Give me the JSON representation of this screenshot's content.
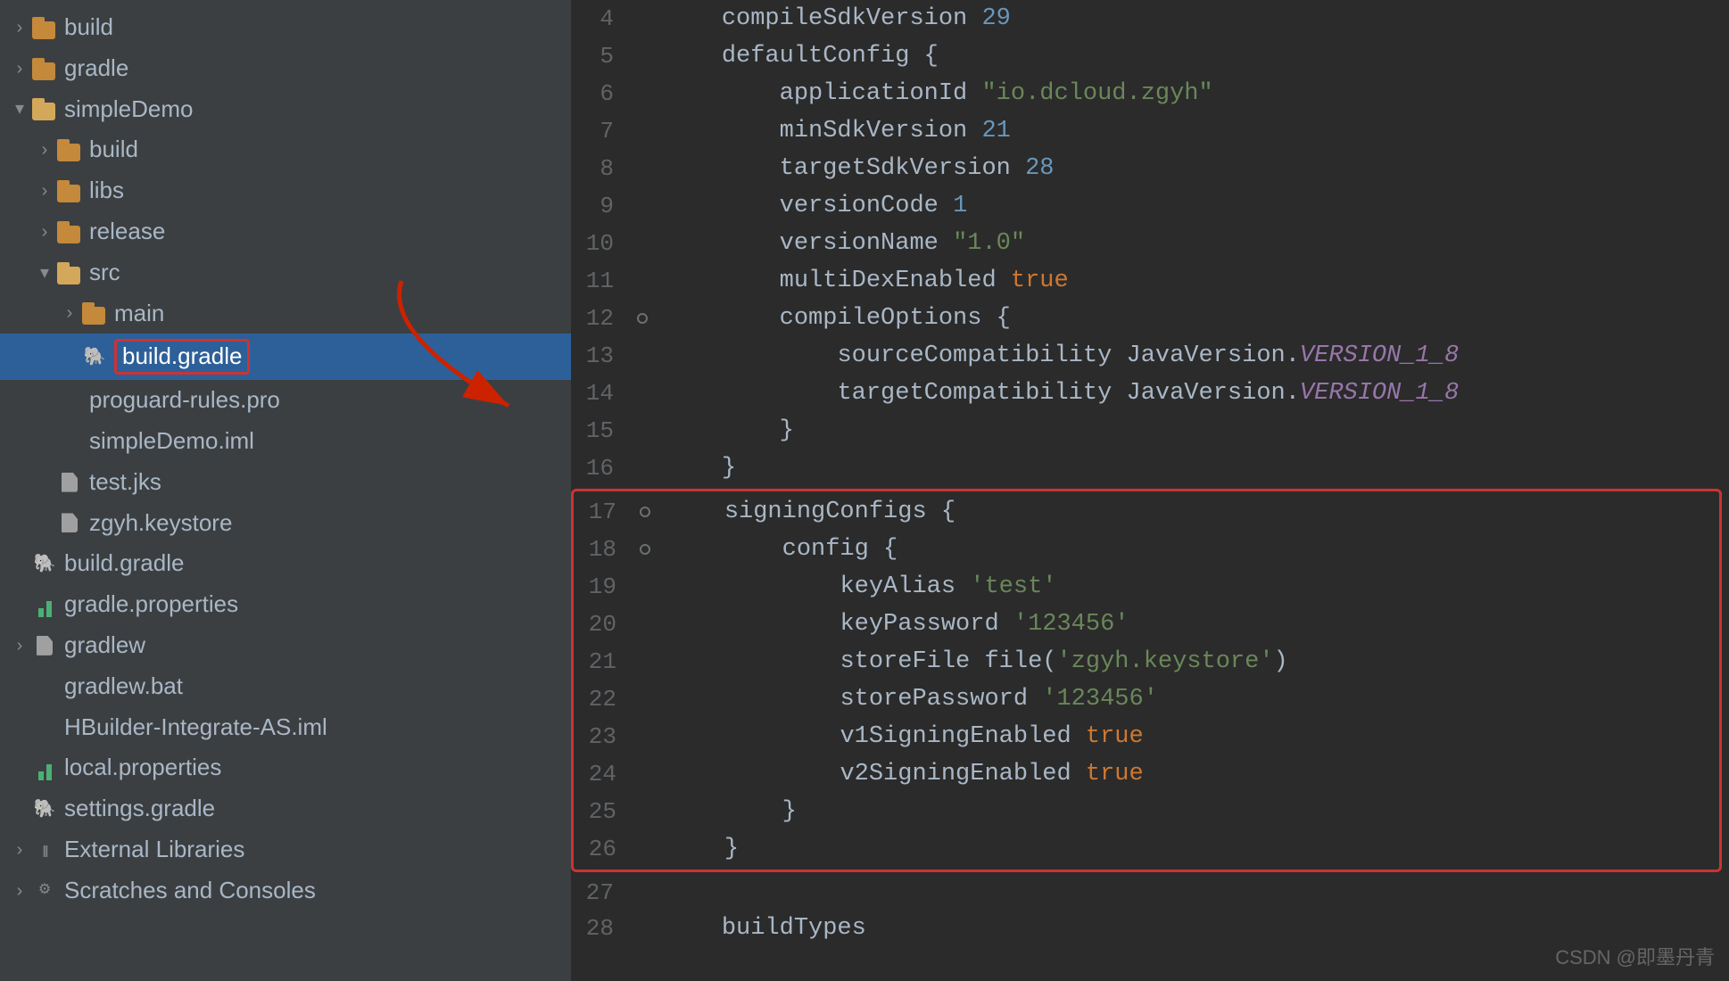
{
  "sidebar": {
    "items": [
      {
        "id": "build-top",
        "label": "build",
        "indent": 0,
        "icon": "folder",
        "chevron": "closed",
        "selected": false
      },
      {
        "id": "gradle",
        "label": "gradle",
        "indent": 0,
        "icon": "folder",
        "chevron": "closed",
        "selected": false
      },
      {
        "id": "simpleDemo",
        "label": "simpleDemo",
        "indent": 0,
        "icon": "folder",
        "chevron": "open",
        "selected": false
      },
      {
        "id": "build",
        "label": "build",
        "indent": 1,
        "icon": "folder",
        "chevron": "closed",
        "selected": false
      },
      {
        "id": "libs",
        "label": "libs",
        "indent": 1,
        "icon": "folder",
        "chevron": "closed",
        "selected": false
      },
      {
        "id": "release",
        "label": "release",
        "indent": 1,
        "icon": "folder",
        "chevron": "closed",
        "selected": false
      },
      {
        "id": "src",
        "label": "src",
        "indent": 1,
        "icon": "folder-open",
        "chevron": "open",
        "selected": false
      },
      {
        "id": "main",
        "label": "main",
        "indent": 2,
        "icon": "folder",
        "chevron": "closed",
        "selected": false
      },
      {
        "id": "build-gradle-child",
        "label": "build.gradle",
        "indent": 2,
        "icon": "gradle",
        "chevron": "empty",
        "selected": true
      },
      {
        "id": "proguard",
        "label": "proguard-rules.pro",
        "indent": 1,
        "icon": "file-pro",
        "chevron": "empty",
        "selected": false
      },
      {
        "id": "simpleDemo-iml",
        "label": "simpleDemo.iml",
        "indent": 1,
        "icon": "file-iml",
        "chevron": "empty",
        "selected": false
      },
      {
        "id": "test-jks",
        "label": "test.jks",
        "indent": 1,
        "icon": "file",
        "chevron": "empty",
        "selected": false
      },
      {
        "id": "zgyh-keystore",
        "label": "zgyh.keystore",
        "indent": 1,
        "icon": "file",
        "chevron": "empty",
        "selected": false
      },
      {
        "id": "build-gradle-root",
        "label": "build.gradle",
        "indent": 0,
        "icon": "gradle",
        "chevron": "empty",
        "selected": false
      },
      {
        "id": "gradle-properties",
        "label": "gradle.properties",
        "indent": 0,
        "icon": "chart",
        "chevron": "empty",
        "selected": false
      },
      {
        "id": "gradlew",
        "label": "gradlew",
        "indent": 0,
        "icon": "file",
        "chevron": "closed",
        "selected": false
      },
      {
        "id": "gradlew-bat",
        "label": "gradlew.bat",
        "indent": 0,
        "icon": "file-pro",
        "chevron": "empty",
        "selected": false
      },
      {
        "id": "hbuilder-iml",
        "label": "HBuilder-Integrate-AS.iml",
        "indent": 0,
        "icon": "file-iml",
        "chevron": "empty",
        "selected": false
      },
      {
        "id": "local-properties",
        "label": "local.properties",
        "indent": 0,
        "icon": "chart",
        "chevron": "empty",
        "selected": false
      },
      {
        "id": "settings-gradle",
        "label": "settings.gradle",
        "indent": 0,
        "icon": "gradle",
        "chevron": "empty",
        "selected": false
      },
      {
        "id": "external-libraries",
        "label": "External Libraries",
        "indent": 0,
        "icon": "ext",
        "chevron": "closed",
        "selected": false
      },
      {
        "id": "scratches",
        "label": "Scratches and Consoles",
        "indent": 0,
        "icon": "scratches",
        "chevron": "closed",
        "selected": false
      }
    ]
  },
  "code": {
    "lines": [
      {
        "num": 4,
        "gutter": false,
        "content": "    compileSdkVersion 29",
        "tokens": [
          {
            "t": "normal",
            "v": "    compileSdkVersion "
          },
          {
            "t": "num",
            "v": "29"
          }
        ]
      },
      {
        "num": 5,
        "gutter": false,
        "content": "    defaultConfig {",
        "tokens": [
          {
            "t": "normal",
            "v": "    defaultConfig "
          },
          {
            "t": "brace",
            "v": "{"
          }
        ]
      },
      {
        "num": 6,
        "gutter": false,
        "content": "        applicationId \"io.dcloud.zgyh\"",
        "tokens": [
          {
            "t": "normal",
            "v": "        applicationId "
          },
          {
            "t": "str",
            "v": "\"io.dcloud.zgyh\""
          }
        ]
      },
      {
        "num": 7,
        "gutter": false,
        "content": "        minSdkVersion 21",
        "tokens": [
          {
            "t": "normal",
            "v": "        minSdkVersion "
          },
          {
            "t": "num",
            "v": "21"
          }
        ]
      },
      {
        "num": 8,
        "gutter": false,
        "content": "        targetSdkVersion 28",
        "tokens": [
          {
            "t": "normal",
            "v": "        targetSdkVersion "
          },
          {
            "t": "num",
            "v": "28"
          }
        ]
      },
      {
        "num": 9,
        "gutter": false,
        "content": "        versionCode 1",
        "tokens": [
          {
            "t": "normal",
            "v": "        versionCode "
          },
          {
            "t": "num",
            "v": "1"
          }
        ]
      },
      {
        "num": 10,
        "gutter": false,
        "content": "        versionName \"1.0\"",
        "tokens": [
          {
            "t": "normal",
            "v": "        versionName "
          },
          {
            "t": "str",
            "v": "\"1.0\""
          }
        ]
      },
      {
        "num": 11,
        "gutter": false,
        "content": "        multiDexEnabled true",
        "tokens": [
          {
            "t": "normal",
            "v": "        multiDexEnabled "
          },
          {
            "t": "kw",
            "v": "true"
          }
        ]
      },
      {
        "num": 12,
        "gutter": true,
        "content": "        compileOptions {",
        "tokens": [
          {
            "t": "normal",
            "v": "        compileOptions "
          },
          {
            "t": "brace",
            "v": "{"
          }
        ]
      },
      {
        "num": 13,
        "gutter": false,
        "content": "            sourceCompatibility JavaVersion.VERSION_1_8",
        "tokens": [
          {
            "t": "normal",
            "v": "            sourceCompatibility JavaVersion."
          },
          {
            "t": "italic-purple",
            "v": "VERSION_1_8"
          }
        ]
      },
      {
        "num": 14,
        "gutter": false,
        "content": "            targetCompatibility JavaVersion.VERSION_1_8",
        "tokens": [
          {
            "t": "normal",
            "v": "            targetCompatibility JavaVersion."
          },
          {
            "t": "italic-purple",
            "v": "VERSION_1_8"
          }
        ]
      },
      {
        "num": 15,
        "gutter": false,
        "content": "        }",
        "tokens": [
          {
            "t": "brace",
            "v": "        }"
          }
        ]
      },
      {
        "num": 16,
        "gutter": false,
        "content": "    }",
        "tokens": [
          {
            "t": "brace",
            "v": "    }"
          }
        ]
      },
      {
        "num": 17,
        "gutter": true,
        "content": "    signingConfigs {",
        "highlight": "start",
        "tokens": [
          {
            "t": "normal",
            "v": "    signingConfigs "
          },
          {
            "t": "brace",
            "v": "{"
          }
        ]
      },
      {
        "num": 18,
        "gutter": true,
        "content": "        config {",
        "highlight": "mid",
        "tokens": [
          {
            "t": "normal",
            "v": "        config "
          },
          {
            "t": "brace",
            "v": "{"
          }
        ]
      },
      {
        "num": 19,
        "gutter": false,
        "content": "            keyAlias 'test'",
        "highlight": "mid",
        "tokens": [
          {
            "t": "normal",
            "v": "            keyAlias "
          },
          {
            "t": "str",
            "v": "'test'"
          }
        ]
      },
      {
        "num": 20,
        "gutter": false,
        "content": "            keyPassword '123456'",
        "highlight": "mid",
        "tokens": [
          {
            "t": "normal",
            "v": "            keyPassword "
          },
          {
            "t": "str",
            "v": "'123456'"
          }
        ]
      },
      {
        "num": 21,
        "gutter": false,
        "content": "            storeFile file('zgyh.keystore')",
        "highlight": "mid",
        "tokens": [
          {
            "t": "normal",
            "v": "            storeFile file("
          },
          {
            "t": "str",
            "v": "'zgyh.keystore'"
          },
          {
            "t": "normal",
            "v": ")"
          }
        ]
      },
      {
        "num": 22,
        "gutter": false,
        "content": "            storePassword '123456'",
        "highlight": "mid",
        "tokens": [
          {
            "t": "normal",
            "v": "            storePassword "
          },
          {
            "t": "str",
            "v": "'123456'"
          }
        ]
      },
      {
        "num": 23,
        "gutter": false,
        "content": "            v1SigningEnabled true",
        "highlight": "mid",
        "tokens": [
          {
            "t": "normal",
            "v": "            v1SigningEnabled "
          },
          {
            "t": "kw",
            "v": "true"
          }
        ]
      },
      {
        "num": 24,
        "gutter": false,
        "content": "            v2SigningEnabled true",
        "highlight": "mid",
        "tokens": [
          {
            "t": "normal",
            "v": "            v2SigningEnabled "
          },
          {
            "t": "kw",
            "v": "true"
          }
        ]
      },
      {
        "num": 25,
        "gutter": false,
        "content": "        }",
        "highlight": "mid",
        "tokens": [
          {
            "t": "brace",
            "v": "        }"
          }
        ]
      },
      {
        "num": 26,
        "gutter": false,
        "content": "    }",
        "highlight": "end",
        "tokens": [
          {
            "t": "brace",
            "v": "    }"
          }
        ]
      },
      {
        "num": 27,
        "gutter": false,
        "content": "",
        "tokens": []
      },
      {
        "num": 28,
        "gutter": false,
        "content": "    buildTypes",
        "tokens": [
          {
            "t": "normal",
            "v": "    buildTypes"
          }
        ]
      }
    ]
  },
  "watermark": "CSDN @即墨丹青"
}
